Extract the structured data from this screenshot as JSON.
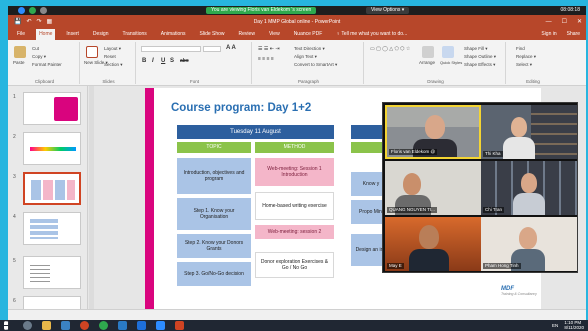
{
  "zoom": {
    "banner_text": "You are viewing Floris van Eldekom 's screen",
    "view_options": "View Options ▾",
    "top_right": "08:08:18"
  },
  "titlebar": {
    "title": "Day 1 MMP Global online - PowerPoint",
    "qat": [
      "💾",
      "↶",
      "↷",
      "▦"
    ],
    "window_controls": [
      "—",
      "☐",
      "✕"
    ]
  },
  "ribbon_tabs": {
    "tabs": [
      "File",
      "Home",
      "Insert",
      "Design",
      "Transitions",
      "Animations",
      "Slide Show",
      "Review",
      "View",
      "Nuance PDF"
    ],
    "tell_me": "♀ Tell me what you want to do...",
    "sign_in": "Sign in",
    "share": "Share"
  },
  "ribbon": {
    "clipboard": {
      "paste": "Paste",
      "cut": "Cut",
      "copy": "Copy ▾",
      "format_painter": "Format Painter",
      "group": "Clipboard"
    },
    "slides": {
      "new_slide": "New Slide ▾",
      "layout": "Layout ▾",
      "reset": "Reset",
      "section": "Section ▾",
      "group": "Slides"
    },
    "font": {
      "group": "Font",
      "bold": "B",
      "italic": "I",
      "underline": "U",
      "shadow": "S",
      "strike": "abc",
      "aa": "A A"
    },
    "paragraph": {
      "text_direction": "Text Direction ▾",
      "align_text": "Align Text ▾",
      "smartart": "Convert to SmartArt ▾",
      "group": "Paragraph"
    },
    "drawing": {
      "arrange": "Arrange",
      "quick_styles": "Quick Styles",
      "shape_fill": "Shape Fill ▾",
      "shape_outline": "Shape Outline ▾",
      "shape_effects": "Shape Effects ▾",
      "group": "Drawing"
    },
    "editing": {
      "find": "Find",
      "replace": "Replace ▾",
      "select": "Select ▾",
      "group": "Editing"
    }
  },
  "thumbnails": {
    "numbers": [
      "1",
      "2",
      "3",
      "4",
      "5",
      "6"
    ],
    "selected": 3
  },
  "slide": {
    "title": "Course program: Day 1+2",
    "day_header": "Tuesday 11 August",
    "topic_header": "TOPIC",
    "method_header": "METHOD",
    "topics": [
      "Introduction, objectives and program",
      "Step 1. Know your Organisation",
      "Step 2. Know your Donors Grants",
      "Step 3. Go/No-Go decision"
    ],
    "methods": [
      "Web-meeting: Session 1 Introduction",
      "Home-based writing exercise",
      "Web-meeting: session 2",
      "Donor exploration Exercises & Go / No Go"
    ],
    "partial_col": [
      "Know y",
      "Propo Mini",
      "Design an intr"
    ],
    "logo": "MDF",
    "logo_sub": "Training & Consultancy"
  },
  "participants": [
    {
      "name": "Floris van Eldekom @"
    },
    {
      "name": "Thi Kha"
    },
    {
      "name": "QUANG NGUYEN TI..."
    },
    {
      "name": "Chi Tran"
    },
    {
      "name": "May E"
    },
    {
      "name": "Pham Hong Tinh"
    }
  ],
  "taskbar": {
    "tray_lang": "EN",
    "time": "1:10 PM",
    "date": "8/11/2020"
  }
}
